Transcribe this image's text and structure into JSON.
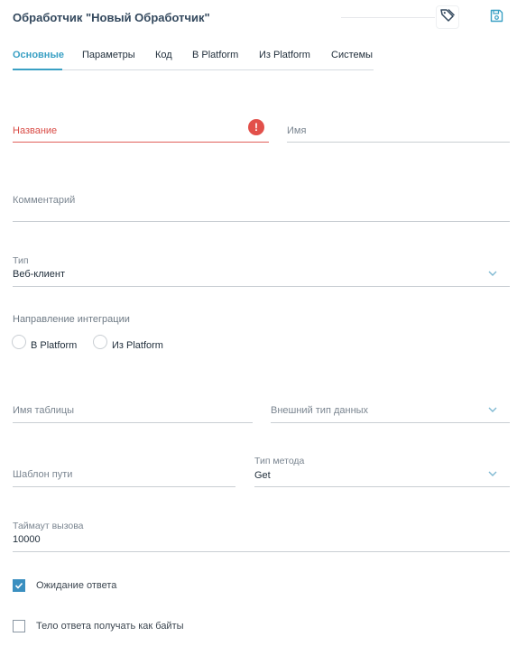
{
  "header": {
    "title": "Обработчик \"Новый Обработчик\""
  },
  "tabs": [
    {
      "label": "Основные"
    },
    {
      "label": "Параметры"
    },
    {
      "label": "Код"
    },
    {
      "label": "В Platform"
    },
    {
      "label": "Из Platform"
    },
    {
      "label": "Системы"
    }
  ],
  "form": {
    "name": {
      "placeholder": "Название"
    },
    "id": {
      "placeholder": "Имя"
    },
    "comment": {
      "placeholder": "Комментарий"
    },
    "type": {
      "label": "Тип",
      "value": "Веб-клиент"
    },
    "direction": {
      "label": "Направление интеграции",
      "options": [
        "В Platform",
        "Из Platform"
      ]
    },
    "table_name": {
      "placeholder": "Имя таблицы"
    },
    "external_type": {
      "placeholder": "Внешний тип данных"
    },
    "path_template": {
      "placeholder": "Шаблон пути"
    },
    "method": {
      "label": "Тип метода",
      "value": "Get"
    },
    "timeout": {
      "label": "Таймаут вызова",
      "value": "10000"
    },
    "wait_response": {
      "label": "Ожидание ответа",
      "checked": true
    },
    "body_as_bytes": {
      "label": "Тело ответа получать как байты",
      "checked": false
    }
  },
  "colors": {
    "accent": "#3aa0c4",
    "error": "#e2504a",
    "checkbox": "#3a8fc0"
  }
}
